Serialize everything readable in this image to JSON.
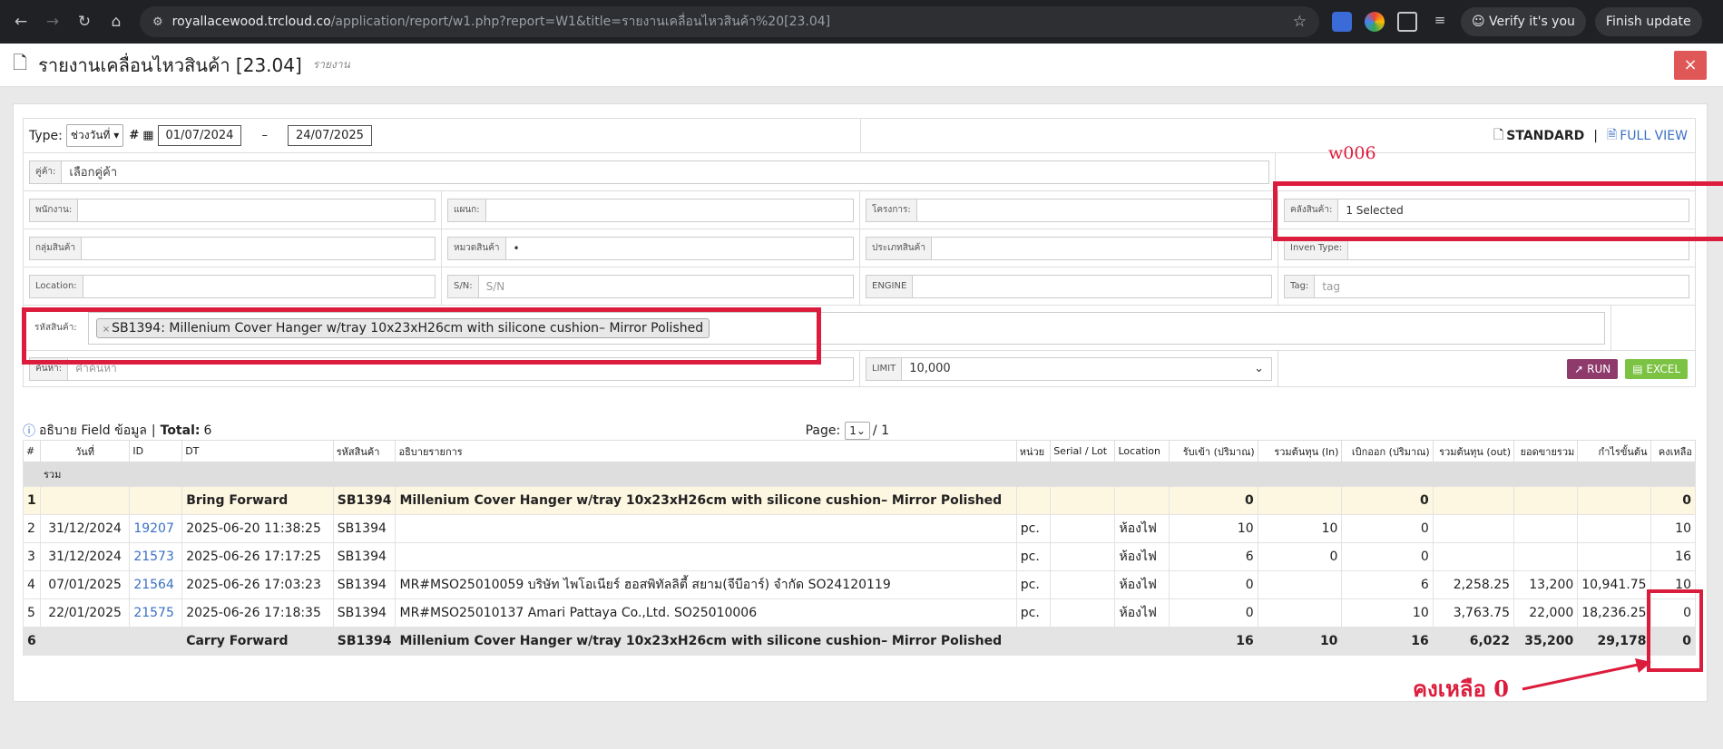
{
  "browser": {
    "url_host": "royallacewood.trcloud.co",
    "url_path": "/application/report/w1.php?report=W1&title=รายงานเคลื่อนไหวสินค้า%20[23.04]",
    "verify": "Verify it's you",
    "finish": "Finish update"
  },
  "header": {
    "title": "รายงานเคลื่อนไหวสินค้า [23.04]",
    "subtitle": "รายงาน",
    "close": "×"
  },
  "filters": {
    "type_label": "Type:",
    "type_value": "ช่วงวันที่",
    "date_from": "01/07/2024",
    "date_sep": "–",
    "date_to": "24/07/2025",
    "standard": "STANDARD",
    "sep": "|",
    "full_view": "FULL VIEW",
    "customer_label": "คู่ค้า:",
    "customer_ph": "เลือกคู่ค้า",
    "employee_label": "พนักงาน:",
    "dept_label": "แผนก:",
    "project_label": "โครงการ:",
    "warehouse_label": "คลังสินค้า:",
    "warehouse_value": "1 Selected",
    "group_label": "กลุ่มสินค้า",
    "category_label": "หมวดสินค้า",
    "category_value": "•",
    "ptype_label": "ประเภทสินค้า",
    "inven_label": "Inven Type:",
    "location_label": "Location:",
    "sn_label": "S/N:",
    "sn_ph": "S/N",
    "engine_label": "ENGINE",
    "tag_label": "Tag:",
    "tag_ph": "tag",
    "product_label": "รหัสสินค้า:",
    "product_chip": "SB1394: Millenium Cover Hanger w/tray 10x23xH26cm with silicone cushion– Mirror Polished",
    "chip_x": "×",
    "search_label": "ค้นหา:",
    "search_ph": "คำค้นหา",
    "limit_label": "LIMIT",
    "limit_value": "10,000",
    "run": "RUN",
    "excel": "EXCEL"
  },
  "info": {
    "text": "อธิบาย Field ข้อมูล",
    "total_label": "Total:",
    "total": "6",
    "page_label": "Page:",
    "page": "1",
    "page_of": "/ 1"
  },
  "table": {
    "headers": [
      "#",
      "วันที่",
      "ID",
      "DT",
      "รหัสสินค้า",
      "อธิบายรายการ",
      "หน่วย",
      "Serial / Lot",
      "Location",
      "รับเข้า (ปริมาณ)",
      "รวมต้นทุน (In)",
      "เบิกออก (ปริมาณ)",
      "รวมต้นทุน (out)",
      "ยอดขายรวม",
      "กำไรขั้นต้น",
      "คงเหลือ"
    ],
    "sum_label": "รวม",
    "rows": [
      [
        "1",
        "",
        "",
        "Bring Forward",
        "SB1394",
        "Millenium Cover Hanger w/tray 10x23xH26cm with silicone cushion– Mirror Polished",
        "",
        "",
        "",
        "0",
        "",
        "0",
        "",
        "",
        "",
        "0"
      ],
      [
        "2",
        "31/12/2024",
        "19207",
        "2025-06-20 11:38:25",
        "SB1394",
        "",
        "pc.",
        "",
        "ห้องไฟ",
        "10",
        "10",
        "0",
        "",
        "",
        "",
        "10"
      ],
      [
        "3",
        "31/12/2024",
        "21573",
        "2025-06-26 17:17:25",
        "SB1394",
        "",
        "pc.",
        "",
        "ห้องไฟ",
        "6",
        "0",
        "0",
        "",
        "",
        "",
        "16"
      ],
      [
        "4",
        "07/01/2025",
        "21564",
        "2025-06-26 17:03:23",
        "SB1394",
        "MR#MSO25010059 บริษัท ไพโอเนียร์ ฮอสพิทัลลิตี้ สยาม(จีบีอาร์) จำกัด SO24120119",
        "pc.",
        "",
        "ห้องไฟ",
        "0",
        "",
        "6",
        "2,258.25",
        "13,200",
        "10,941.75",
        "10"
      ],
      [
        "5",
        "22/01/2025",
        "21575",
        "2025-06-26 17:18:35",
        "SB1394",
        "MR#MSO25010137 Amari Pattaya Co.,Ltd. SO25010006",
        "pc.",
        "",
        "ห้องไฟ",
        "0",
        "",
        "10",
        "3,763.75",
        "22,000",
        "18,236.25",
        "0"
      ],
      [
        "6",
        "",
        "",
        "Carry Forward",
        "SB1394",
        "Millenium Cover Hanger w/tray 10x23xH26cm with silicone cushion– Mirror Polished",
        "",
        "",
        "",
        "16",
        "10",
        "16",
        "6,022",
        "35,200",
        "29,178",
        "0"
      ]
    ]
  },
  "annotations": {
    "w006": "w006",
    "remain": "คงเหลือ 0"
  },
  "colors": {
    "annotation": "#dc1c3c",
    "run": "#8e3a6b",
    "excel": "#7cc243",
    "close": "#e05757"
  }
}
